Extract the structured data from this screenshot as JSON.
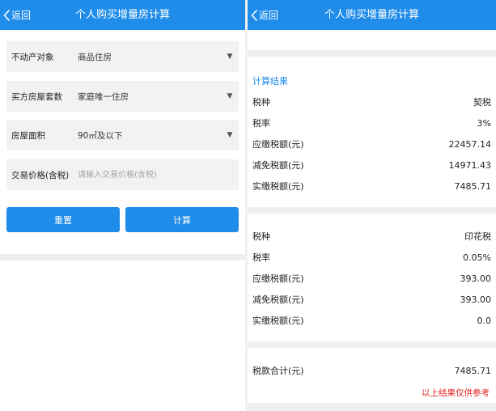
{
  "left": {
    "header": {
      "back_label": "返回",
      "title": "个人购买增量房计算"
    },
    "form": {
      "rows": [
        {
          "label": "不动产对象",
          "value": "商品住房"
        },
        {
          "label": "买方房屋套数",
          "value": "家庭唯一住房"
        },
        {
          "label": "房屋面积",
          "value": "90㎡及以下"
        }
      ],
      "price": {
        "label": "交易价格(含税)",
        "placeholder": "请输入交易价格(含税)"
      }
    },
    "buttons": {
      "reset": "重置",
      "calculate": "计算"
    }
  },
  "right": {
    "header": {
      "back_label": "返回",
      "title": "个人购买增量房计算"
    },
    "section_title": "计算结果",
    "deed_tax": [
      {
        "label": "税种",
        "value": "契税"
      },
      {
        "label": "税率",
        "value": "3%"
      },
      {
        "label": "应缴税额(元)",
        "value": "22457.14"
      },
      {
        "label": "减免税额(元)",
        "value": "14971.43"
      },
      {
        "label": "实缴税额(元)",
        "value": "7485.71"
      }
    ],
    "stamp_tax": [
      {
        "label": "税种",
        "value": "印花税"
      },
      {
        "label": "税率",
        "value": "0.05%"
      },
      {
        "label": "应缴税额(元)",
        "value": "393.00"
      },
      {
        "label": "减免税额(元)",
        "value": "393.00"
      },
      {
        "label": "实缴税额(元)",
        "value": "0.0"
      }
    ],
    "total": {
      "label": "税款合计(元)",
      "value": "7485.71"
    },
    "note": "以上结果仅供参考"
  },
  "colors": {
    "primary": "#1f8cea",
    "note": "#e02020",
    "field_bg": "#f2f2f2"
  }
}
